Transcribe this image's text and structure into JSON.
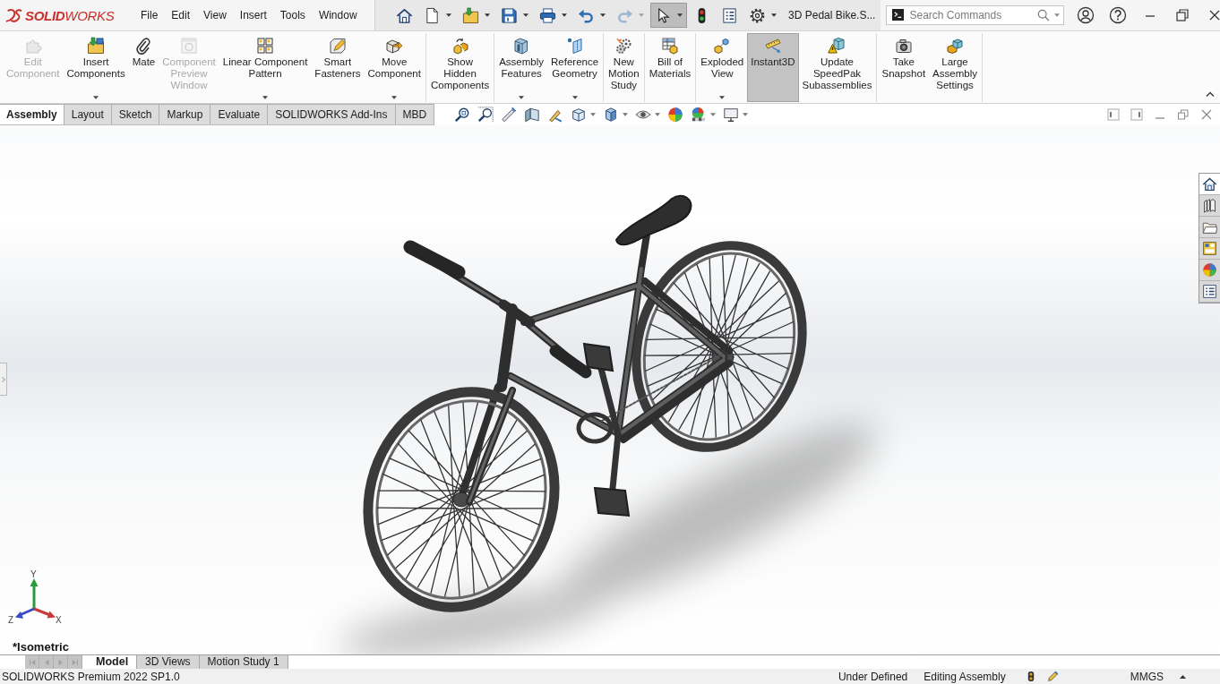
{
  "title_bar": {
    "logo": "**SOLID**WORKS",
    "menus": [
      "File",
      "Edit",
      "View",
      "Insert",
      "Tools",
      "Window"
    ],
    "quick_access": [
      {
        "dropdown": false,
        "disabled": false,
        "selected": false
      },
      {
        "dropdown": true,
        "disabled": false,
        "selected": false
      },
      {
        "dropdown": true,
        "disabled": false,
        "selected": false
      },
      {
        "dropdown": true,
        "disabled": false,
        "selected": false
      },
      {
        "dropdown": true,
        "disabled": false,
        "selected": false
      },
      {
        "dropdown": true,
        "disabled": false,
        "selected": false
      },
      {
        "dropdown": true,
        "disabled": true,
        "selected": false
      },
      {
        "dropdown": true,
        "disabled": false,
        "selected": true
      },
      {
        "dropdown": false,
        "disabled": false,
        "selected": false
      },
      {
        "dropdown": false,
        "disabled": false,
        "selected": false
      },
      {
        "dropdown": true,
        "disabled": false,
        "selected": false
      }
    ],
    "document_title": "3D Pedal Bike.S...",
    "search": {
      "placeholder": "Search Commands"
    }
  },
  "ribbon": {
    "groups": [
      {
        "commands": [
          {
            "label": "Edit\nComponent",
            "disabled": true,
            "selected": false,
            "dropdown": false
          },
          {
            "label": "Insert\nComponents",
            "disabled": false,
            "selected": false,
            "dropdown": true
          },
          {
            "label": "Mate",
            "disabled": false,
            "selected": false,
            "dropdown": false
          },
          {
            "label": "Component\nPreview\nWindow",
            "disabled": true,
            "selected": false,
            "dropdown": false
          },
          {
            "label": "Linear Component\nPattern",
            "disabled": false,
            "selected": false,
            "dropdown": true
          },
          {
            "label": "Smart\nFasteners",
            "disabled": false,
            "selected": false,
            "dropdown": false
          },
          {
            "label": "Move\nComponent",
            "disabled": false,
            "selected": false,
            "dropdown": true
          }
        ]
      },
      {
        "commands": [
          {
            "label": "Show\nHidden\nComponents",
            "disabled": false,
            "selected": false,
            "dropdown": false
          }
        ]
      },
      {
        "commands": [
          {
            "label": "Assembly\nFeatures",
            "disabled": false,
            "selected": false,
            "dropdown": true
          },
          {
            "label": "Reference\nGeometry",
            "disabled": false,
            "selected": false,
            "dropdown": true
          }
        ]
      },
      {
        "commands": [
          {
            "label": "New\nMotion\nStudy",
            "disabled": false,
            "selected": false,
            "dropdown": false
          }
        ]
      },
      {
        "commands": [
          {
            "label": "Bill of\nMaterials",
            "disabled": false,
            "selected": false,
            "dropdown": false
          }
        ]
      },
      {
        "commands": [
          {
            "label": "Exploded\nView",
            "disabled": false,
            "selected": false,
            "dropdown": true
          },
          {
            "label": "Instant3D",
            "disabled": false,
            "selected": true,
            "dropdown": false
          },
          {
            "label": "Update\nSpeedPak\nSubassemblies",
            "disabled": false,
            "selected": false,
            "dropdown": false
          }
        ]
      },
      {
        "commands": [
          {
            "label": "Take\nSnapshot",
            "disabled": false,
            "selected": false,
            "dropdown": false
          },
          {
            "label": "Large\nAssembly\nSettings",
            "disabled": false,
            "selected": false,
            "dropdown": false
          }
        ]
      }
    ]
  },
  "command_tabs": [
    {
      "label": "Assembly",
      "selected": true
    },
    {
      "label": "Layout",
      "selected": false
    },
    {
      "label": "Sketch",
      "selected": false
    },
    {
      "label": "Markup",
      "selected": false
    },
    {
      "label": "Evaluate",
      "selected": false
    },
    {
      "label": "SOLIDWORKS Add-Ins",
      "selected": false
    },
    {
      "label": "MBD",
      "selected": false
    }
  ],
  "task_pane": [
    {
      "selected": true
    },
    {
      "selected": false
    },
    {
      "selected": false
    },
    {
      "selected": false
    },
    {
      "selected": false
    },
    {
      "selected": false
    }
  ],
  "viewport": {
    "view_name": "*Isometric",
    "triad": {
      "x": "X",
      "y": "Y",
      "z": "Z"
    }
  },
  "model_tabs": {
    "scroll_disabled": true,
    "tabs": [
      {
        "label": "Model",
        "selected": true
      },
      {
        "label": "3D Views",
        "selected": false
      },
      {
        "label": "Motion Study 1",
        "selected": false
      }
    ]
  },
  "status_bar": {
    "product": "SOLIDWORKS Premium 2022 SP1.0",
    "sketch_state": "Under Defined",
    "mode": "Editing Assembly",
    "units": "MMGS"
  }
}
